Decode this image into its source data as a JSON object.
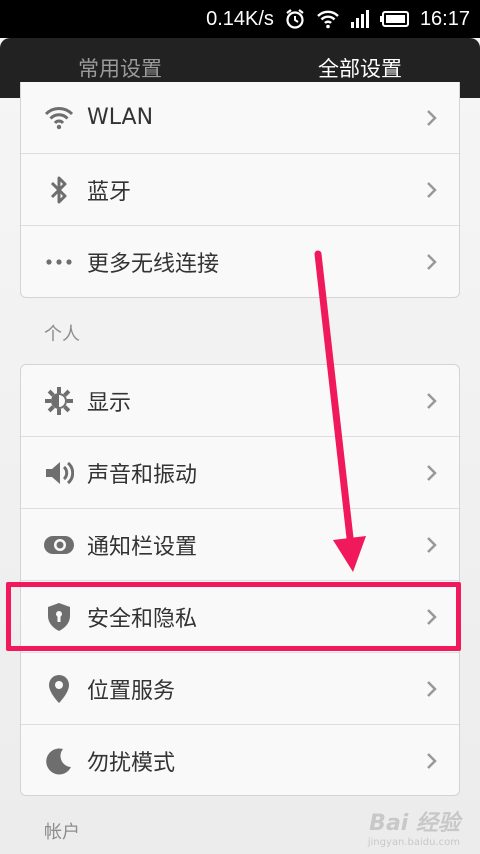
{
  "status_bar": {
    "speed": "0.14K/s",
    "time": "16:17",
    "icons": [
      "alarm-icon",
      "wifi-icon",
      "signal-icon",
      "battery-icon"
    ]
  },
  "tabs": [
    {
      "label": "常用设置",
      "active": false
    },
    {
      "label": "全部设置",
      "active": true
    }
  ],
  "groups": {
    "wireless": [
      {
        "label": "WLAN",
        "icon": "wifi-icon"
      },
      {
        "label": "蓝牙",
        "icon": "bluetooth-icon"
      },
      {
        "label": "更多无线连接",
        "icon": "more-dots-icon"
      }
    ],
    "personal_title": "个人",
    "personal": [
      {
        "label": "显示",
        "icon": "brightness-icon"
      },
      {
        "label": "声音和振动",
        "icon": "speaker-icon"
      },
      {
        "label": "通知栏设置",
        "icon": "toggle-icon"
      },
      {
        "label": "安全和隐私",
        "icon": "shield-icon"
      },
      {
        "label": "位置服务",
        "icon": "location-pin-icon"
      },
      {
        "label": "勿扰模式",
        "icon": "moon-icon"
      }
    ],
    "account_title": "帐户"
  },
  "watermark": {
    "brand": "Bai 经验",
    "url": "jingyan.baidu.com"
  },
  "colors": {
    "highlight": "#f0195c",
    "tabbar_bg": "#222222",
    "icon_gray": "#6e6e6e"
  }
}
